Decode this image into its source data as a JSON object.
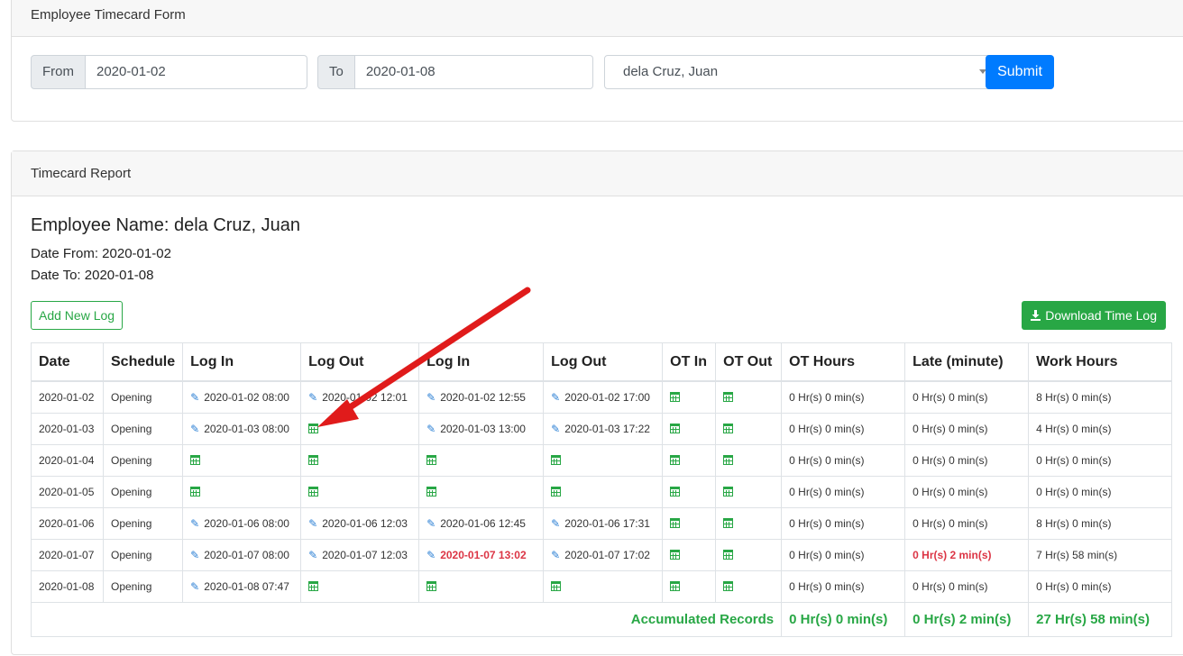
{
  "form": {
    "title": "Employee Timecard Form",
    "from_label": "From",
    "from_value": "2020-01-02",
    "to_label": "To",
    "to_value": "2020-01-08",
    "employee_selected": "dela Cruz, Juan",
    "submit_label": "Submit"
  },
  "report": {
    "title": "Timecard Report",
    "employee_name": "Employee Name: dela Cruz, Juan",
    "date_from": "Date From: 2020-01-02",
    "date_to": "Date To: 2020-01-08",
    "add_log_label": "Add New Log",
    "download_label": "Download Time Log",
    "columns": [
      "Date",
      "Schedule",
      "Log In",
      "Log Out",
      "Log In",
      "Log Out",
      "OT In",
      "OT Out",
      "OT Hours",
      "Late (minute)",
      "Work Hours"
    ],
    "rows": [
      {
        "date": "2020-01-02",
        "schedule": "Opening",
        "login1": "2020-01-02 08:00",
        "logout1": "2020-01-02 12:01",
        "login2": "2020-01-02 12:55",
        "logout2": "2020-01-02 17:00",
        "ot_in": "",
        "ot_out": "",
        "ot_hours": "0 Hr(s) 0 min(s)",
        "late": "0 Hr(s) 0 min(s)",
        "work": "8 Hr(s) 0 min(s)"
      },
      {
        "date": "2020-01-03",
        "schedule": "Opening",
        "login1": "2020-01-03 08:00",
        "logout1": "",
        "login2": "2020-01-03 13:00",
        "logout2": "2020-01-03 17:22",
        "ot_in": "",
        "ot_out": "",
        "ot_hours": "0 Hr(s) 0 min(s)",
        "late": "0 Hr(s) 0 min(s)",
        "work": "4 Hr(s) 0 min(s)"
      },
      {
        "date": "2020-01-04",
        "schedule": "Opening",
        "login1": "",
        "logout1": "",
        "login2": "",
        "logout2": "",
        "ot_in": "",
        "ot_out": "",
        "ot_hours": "0 Hr(s) 0 min(s)",
        "late": "0 Hr(s) 0 min(s)",
        "work": "0 Hr(s) 0 min(s)"
      },
      {
        "date": "2020-01-05",
        "schedule": "Opening",
        "login1": "",
        "logout1": "",
        "login2": "",
        "logout2": "",
        "ot_in": "",
        "ot_out": "",
        "ot_hours": "0 Hr(s) 0 min(s)",
        "late": "0 Hr(s) 0 min(s)",
        "work": "0 Hr(s) 0 min(s)"
      },
      {
        "date": "2020-01-06",
        "schedule": "Opening",
        "login1": "2020-01-06 08:00",
        "logout1": "2020-01-06 12:03",
        "login2": "2020-01-06 12:45",
        "logout2": "2020-01-06 17:31",
        "ot_in": "",
        "ot_out": "",
        "ot_hours": "0 Hr(s) 0 min(s)",
        "late": "0 Hr(s) 0 min(s)",
        "work": "8 Hr(s) 0 min(s)"
      },
      {
        "date": "2020-01-07",
        "schedule": "Opening",
        "login1": "2020-01-07 08:00",
        "logout1": "2020-01-07 12:03",
        "login2": "2020-01-07 13:02",
        "logout2": "2020-01-07 17:02",
        "ot_in": "",
        "ot_out": "",
        "ot_hours": "0 Hr(s) 0 min(s)",
        "late": "0 Hr(s) 2 min(s)",
        "work": "7 Hr(s) 58 min(s)",
        "late_flag": true
      },
      {
        "date": "2020-01-08",
        "schedule": "Opening",
        "login1": "2020-01-08 07:47",
        "logout1": "",
        "login2": "",
        "logout2": "",
        "ot_in": "",
        "ot_out": "",
        "ot_hours": "0 Hr(s) 0 min(s)",
        "late": "0 Hr(s) 0 min(s)",
        "work": "0 Hr(s) 0 min(s)"
      }
    ],
    "totals": {
      "label": "Accumulated Records",
      "ot_hours": "0 Hr(s) 0 min(s)",
      "late": "0 Hr(s) 2 min(s)",
      "work": "27 Hr(s) 58 min(s)"
    }
  },
  "colors": {
    "primary": "#007bff",
    "success": "#28a745",
    "danger": "#dc3545",
    "annotation_arrow": "#e01b1b"
  }
}
